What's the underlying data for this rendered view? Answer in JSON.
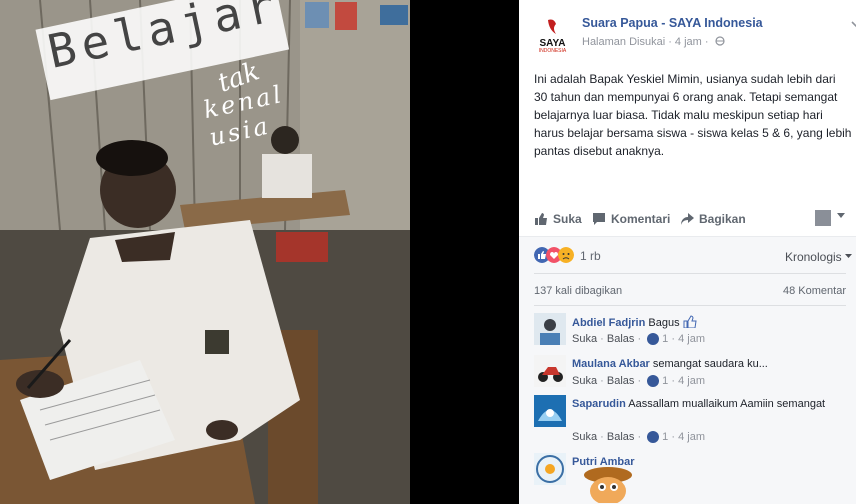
{
  "overlay": {
    "title": "Belajar",
    "sub1": "tak",
    "sub2": "kenal usia"
  },
  "page": {
    "name": "Suara Papua - SAYA Indonesia",
    "meta": "Halaman Disukai · 4 jam ·",
    "logo_text": "SAYA",
    "logo_sub": "INDONESIA"
  },
  "post": {
    "text": "Ini adalah Bapak Yeskiel Mimin, usianya sudah lebih dari 30 tahun dan mempunyai 6 orang anak. Tetapi semangat belajarnya luar biasa. Tidak malu meskipun setiap hari harus belajar bersama siswa - siswa kelas 5 & 6, yang lebih pantas disebut anaknya."
  },
  "actions": {
    "like": "Suka",
    "comment": "Komentari",
    "share": "Bagikan"
  },
  "reactions": {
    "count": "1 rb",
    "order": "Kronologis"
  },
  "stats": {
    "shares": "137 kali dibagikan",
    "comments": "48 Komentar"
  },
  "comments": [
    {
      "name": "Abdiel Fadjrin",
      "text": "Bagus",
      "like": "Suka",
      "reply": "Balas",
      "count": "1",
      "time": "4 jam"
    },
    {
      "name": "Maulana Akbar",
      "text": "semangat saudara ku...",
      "like": "Suka",
      "reply": "Balas",
      "count": "1",
      "time": "4 jam"
    },
    {
      "name": "Saparudin",
      "text": "Aassallam muallaikum Aamiin semangat",
      "like": "Suka",
      "reply": "Balas",
      "count": "1",
      "time": "4 jam"
    },
    {
      "name": "Putri Ambar",
      "text": ""
    }
  ],
  "colors": {
    "link": "#365899",
    "meta": "#90949c",
    "bg_grey": "#f6f7f9"
  },
  "icons": [
    "like-icon",
    "comment-icon",
    "share-icon",
    "chevron-down-icon",
    "globe-icon",
    "like-reaction-icon",
    "love-reaction-icon",
    "sad-reaction-icon"
  ]
}
